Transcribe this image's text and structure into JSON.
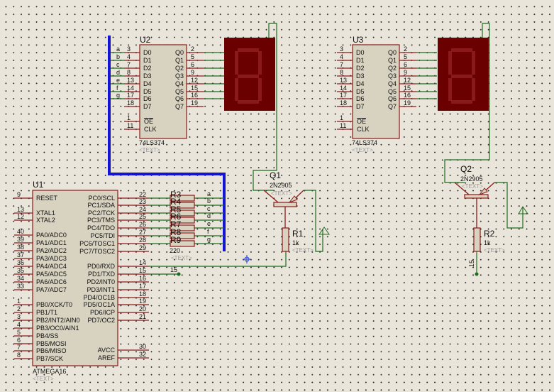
{
  "colors": {
    "wire": "#1f6b1f",
    "pin": "#8b1a1a",
    "bus": "#1414d0",
    "display": "#6a0000",
    "segment": "#8a1a1a",
    "chip": "#d8d2c0"
  },
  "u1": {
    "ref": "U1",
    "part": "ATMEGA16",
    "text": "<TEXT>",
    "left": [
      [
        "9",
        "RESET"
      ],
      [
        "13",
        "XTAL1"
      ],
      [
        "12",
        "XTAL2"
      ],
      [
        "40",
        "PA0/ADC0"
      ],
      [
        "39",
        "PA1/ADC1"
      ],
      [
        "38",
        "PA2/ADC2"
      ],
      [
        "37",
        "PA3/ADC3"
      ],
      [
        "36",
        "PA4/ADC4"
      ],
      [
        "35",
        "PA5/ADC5"
      ],
      [
        "34",
        "PA6/ADC6"
      ],
      [
        "33",
        "PA7/ADC7"
      ],
      [
        "1",
        "PB0/XCK/T0"
      ],
      [
        "2",
        "PB1/T1"
      ],
      [
        "3",
        "PB2/INT2/AIN0"
      ],
      [
        "4",
        "PB3/OC0/AIN1"
      ],
      [
        "5",
        "PB4/SS"
      ],
      [
        "6",
        "PB5/MOSI"
      ],
      [
        "7",
        "PB6/MISO"
      ],
      [
        "8",
        "PB7/SCK"
      ]
    ],
    "right": [
      [
        "22",
        "PC0/SCL"
      ],
      [
        "23",
        "PC1/SDA"
      ],
      [
        "24",
        "PC2/TCK"
      ],
      [
        "25",
        "PC3/TMS"
      ],
      [
        "26",
        "PC4/TDO"
      ],
      [
        "27",
        "PC5/TDI"
      ],
      [
        "28",
        "PC6/TOSC1"
      ],
      [
        "29",
        "PC7/TOSC2"
      ],
      [
        "14",
        "PD0/RXD"
      ],
      [
        "15",
        "PD1/TXD"
      ],
      [
        "16",
        "PD2/INT0"
      ],
      [
        "17",
        "PD3/INT1"
      ],
      [
        "18",
        "PD4/OC1B"
      ],
      [
        "19",
        "PD5/OC1A"
      ],
      [
        "20",
        "PD6/ICP"
      ],
      [
        "21",
        "PD7/OC2"
      ],
      [
        "30",
        "AVCC"
      ],
      [
        "32",
        "AREF"
      ]
    ]
  },
  "resistor_pack": {
    "refs": [
      "R3",
      "R4",
      "R5",
      "R6",
      "R7",
      "R8",
      "R9"
    ],
    "value": "220",
    "text": "<TEXT>",
    "nets": [
      "a",
      "b",
      "c",
      "d",
      "e",
      "f",
      "g"
    ]
  },
  "net_15": "15",
  "u2": {
    "ref": "U2",
    "part": "74LS374",
    "text": "<TEXT>",
    "nets": [
      "a",
      "b",
      "c",
      "d",
      "e",
      "f",
      "g",
      ""
    ],
    "dpins": [
      [
        "3",
        "D0"
      ],
      [
        "4",
        "D1"
      ],
      [
        "7",
        "D2"
      ],
      [
        "8",
        "D3"
      ],
      [
        "13",
        "D4"
      ],
      [
        "14",
        "D5"
      ],
      [
        "17",
        "D6"
      ],
      [
        "18",
        "D7"
      ]
    ],
    "qpins": [
      [
        "2",
        "Q0"
      ],
      [
        "5",
        "Q1"
      ],
      [
        "6",
        "Q2"
      ],
      [
        "9",
        "Q3"
      ],
      [
        "12",
        "Q4"
      ],
      [
        "15",
        "Q5"
      ],
      [
        "16",
        "Q6"
      ],
      [
        "19",
        "Q7"
      ]
    ],
    "oe": [
      "1",
      "OE"
    ],
    "clk": [
      "11",
      "CLK"
    ]
  },
  "u3": {
    "ref": "U3",
    "part": "74LS374",
    "text": "<TEXT>"
  },
  "q1": {
    "ref": "Q1",
    "part": "2N2905",
    "text": "<TEXT>"
  },
  "q2": {
    "ref": "Q2",
    "part": "2N2905",
    "text": "<TEXT>"
  },
  "r1": {
    "ref": "R1",
    "value": "1k",
    "text": "<TEXT>"
  },
  "r2": {
    "ref": "R2",
    "value": "1k",
    "text": "<TEXT>"
  }
}
